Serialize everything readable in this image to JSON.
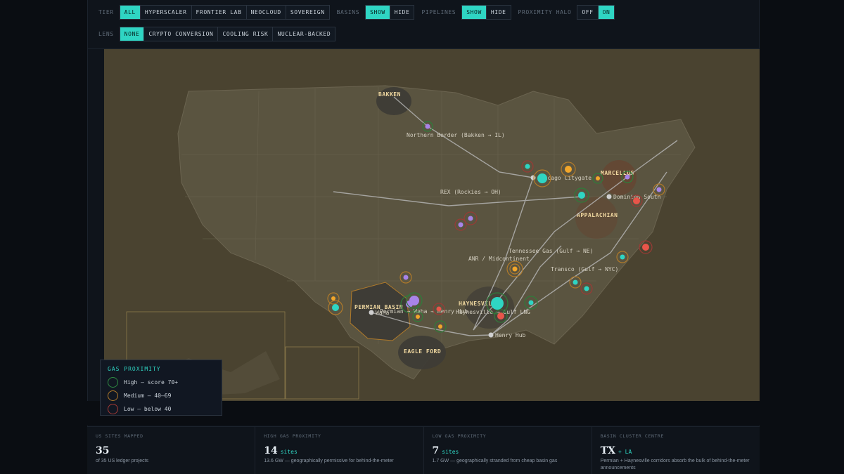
{
  "toolbar": {
    "tier": {
      "label": "TIER",
      "options": [
        "ALL",
        "HYPERSCALER",
        "FRONTIER LAB",
        "NEOCLOUD",
        "SOVEREIGN"
      ],
      "selected": "ALL"
    },
    "basins": {
      "label": "BASINS",
      "options": [
        "SHOW",
        "HIDE"
      ],
      "selected": "SHOW"
    },
    "pipelines": {
      "label": "PIPELINES",
      "options": [
        "SHOW",
        "HIDE"
      ],
      "selected": "SHOW"
    },
    "halo": {
      "label": "PROXIMITY HALO",
      "options": [
        "OFF",
        "ON"
      ],
      "selected": "ON"
    },
    "lens": {
      "label": "LENS",
      "options": [
        "NONE",
        "CRYPTO CONVERSION",
        "COOLING RISK",
        "NUCLEAR-BACKED"
      ],
      "selected": "NONE"
    }
  },
  "colors": {
    "accent": "#2fd5c3",
    "high": "#2e7d3a",
    "medium": "#b07a2a",
    "low": "#9a3a35",
    "site_teal": "#2fd5c3",
    "site_orange": "#f2a62a",
    "site_purple": "#a884e8",
    "site_red": "#e8554a"
  },
  "legend": {
    "title": "GAS PROXIMITY",
    "items": [
      {
        "label": "High — score 70+",
        "color": "#2e8a42"
      },
      {
        "label": "Medium — 40–69",
        "color": "#b07a2a"
      },
      {
        "label": "Low — below 40",
        "color": "#a33a35"
      }
    ]
  },
  "basins": [
    {
      "name": "BAKKEN"
    },
    {
      "name": "MARCELLUS"
    },
    {
      "name": "APPALACHIAN"
    },
    {
      "name": "PERMIAN BASIN"
    },
    {
      "name": "HAYNESVILLE"
    },
    {
      "name": "EAGLE FORD"
    }
  ],
  "pipelines": [
    {
      "name": "Northern Border (Bakken → IL)"
    },
    {
      "name": "REX (Rockies → OH)"
    },
    {
      "name": "Tennessee Gas (Gulf → NE)"
    },
    {
      "name": "ANR / Midcontinent"
    },
    {
      "name": "Transco (Gulf → NYC)"
    },
    {
      "name": "Permian → Waha → Henry Hub"
    },
    {
      "name": "Haynesville → Gulf LNG"
    }
  ],
  "hubs": [
    {
      "name": "Chicago Citygate"
    },
    {
      "name": "Dominion South"
    },
    {
      "name": "Waha"
    },
    {
      "name": "Henry Hub"
    }
  ],
  "stats": [
    {
      "label": "US SITES MAPPED",
      "value": "35",
      "unit": "",
      "note": "of 35 US ledger projects"
    },
    {
      "label": "HIGH GAS PROXIMITY",
      "value": "14",
      "unit": "sites",
      "note": "13.6 GW — geographically permissive for behind-the-meter"
    },
    {
      "label": "LOW GAS PROXIMITY",
      "value": "7",
      "unit": "sites",
      "note": "1.7 GW — geographically stranded from cheap basin gas"
    },
    {
      "label": "BASIN CLUSTER CENTRE",
      "value": "TX",
      "unit": "+ LA",
      "note": "Permian + Haynesville corridors absorb the bulk of behind-the-meter announcements"
    }
  ]
}
